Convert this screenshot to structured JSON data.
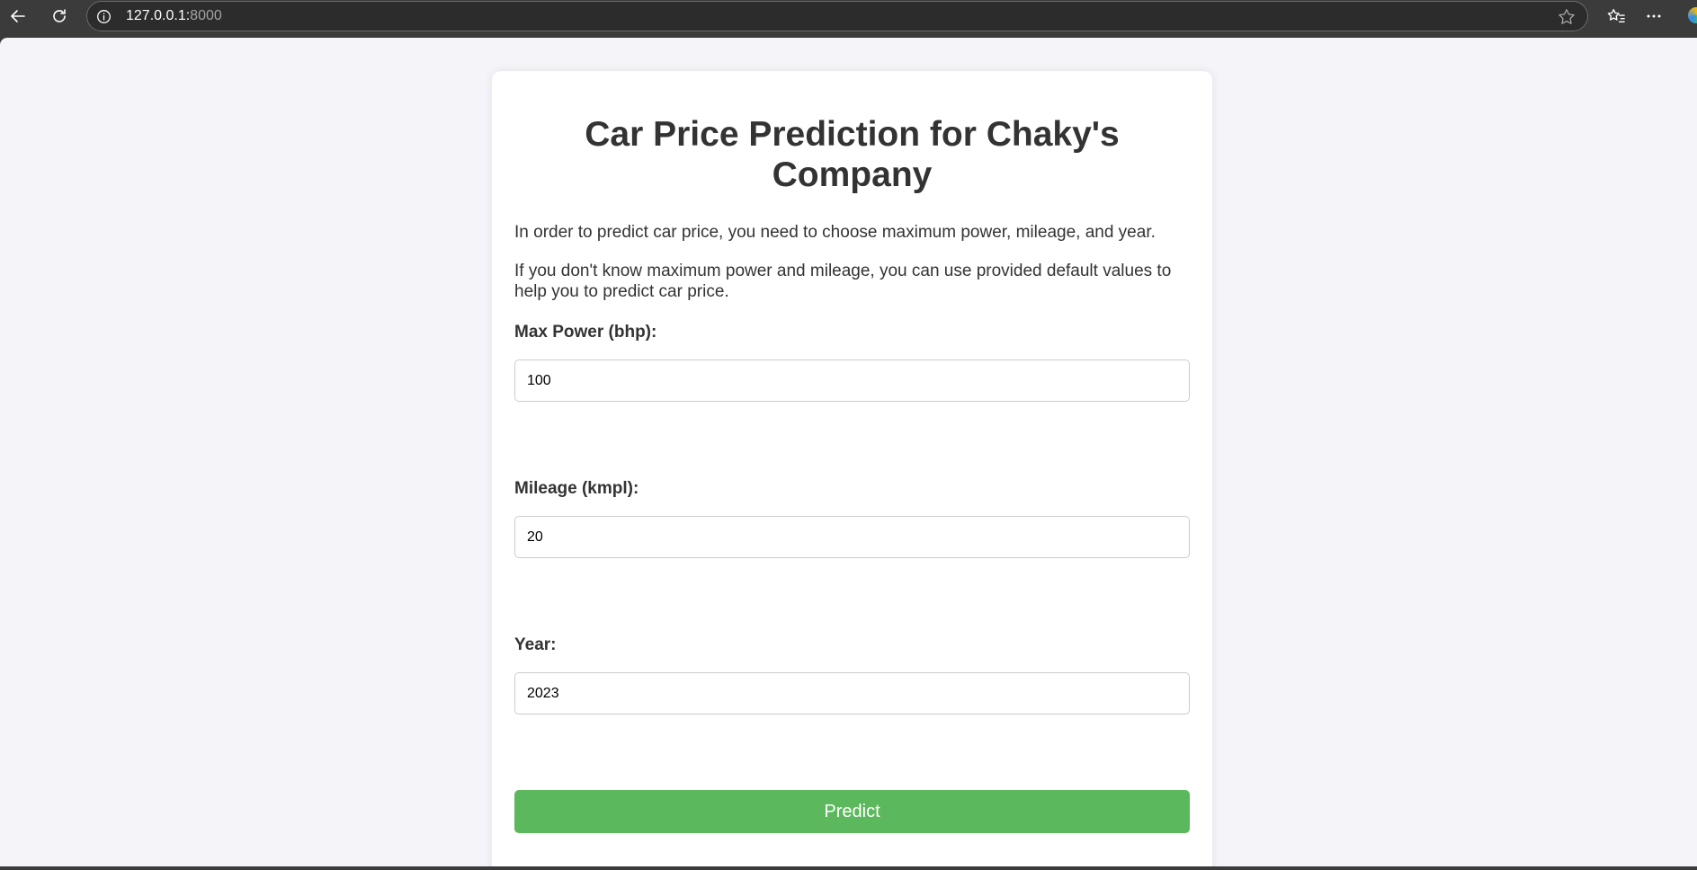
{
  "browser": {
    "url_host": "127.0.0.1:",
    "url_port": "8000"
  },
  "page": {
    "title": "Car Price Prediction for Chaky's Company",
    "intro_1": "In order to predict car price, you need to choose maximum power, mileage, and year.",
    "intro_2": "If you don't know maximum power and mileage, you can use provided default values to help you to predict car price.",
    "max_power": {
      "label": "Max Power (bhp):",
      "value": "100"
    },
    "mileage": {
      "label": "Mileage (kmpl):",
      "value": "20"
    },
    "year": {
      "label": "Year:",
      "value": "2023"
    },
    "predict_label": "Predict"
  },
  "colors": {
    "accent": "#5cb85c",
    "page_bg": "#f4f4f9",
    "toolbar_bg": "#3b3b3b"
  },
  "icons": [
    "back-arrow-icon",
    "refresh-icon",
    "info-icon",
    "star-icon",
    "favorites-icon",
    "more-icon",
    "edge-copilot-icon"
  ]
}
